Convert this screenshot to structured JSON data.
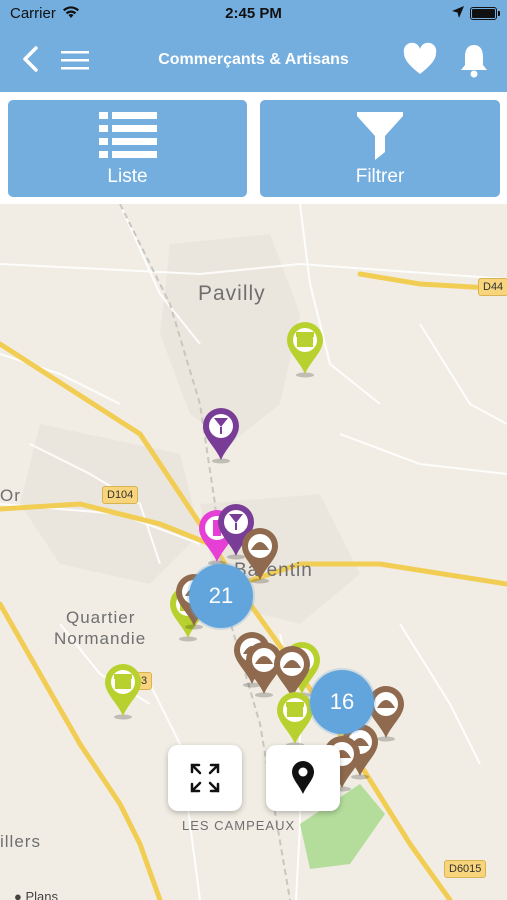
{
  "status": {
    "carrier": "Carrier",
    "time": "2:45 PM"
  },
  "nav": {
    "title": "Commerçants & Artisans",
    "icons": [
      "chevron-left-icon",
      "hamburger-menu-icon",
      "heart-icon",
      "bell-icon"
    ]
  },
  "toolbar": {
    "list_label": "Liste",
    "filter_label": "Filtrer"
  },
  "map": {
    "places": {
      "pavilly": "Pavilly",
      "barentin": "Barentin",
      "quartier": "Quartier",
      "normandie": "Normandie",
      "or": "Or",
      "villers": "illers",
      "campeaux": "LES CAMPEAUX"
    },
    "roads": {
      "d44": "D44",
      "d104": "D104",
      "d6015": "D6015",
      "r3": "3"
    },
    "clusters": [
      "21",
      "16"
    ],
    "attribution": "Plans"
  },
  "colors": {
    "header": "#74aede",
    "cluster": "#62a5dc",
    "pin_green": "#b9d12f",
    "pin_purple": "#7a3d97",
    "pin_brown": "#8f6a4e",
    "pin_magenta": "#e53fd6"
  }
}
